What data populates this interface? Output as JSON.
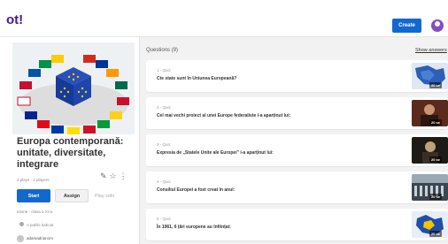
{
  "topbar": {
    "logo": "ot!",
    "create_label": "Create"
  },
  "kahoot": {
    "title": "Europa contemporană: unitate, diversitate, integrare",
    "meta": "2 plays · 2 players",
    "start_label": "Start",
    "assign_label": "Assign",
    "play_solo_label": "Play solo",
    "category": "Istorie · clasa a XI-a",
    "visibility": "A public kahoot",
    "author": "adamadrian1m"
  },
  "questions": {
    "header": "Questions (9)",
    "show_answers": "Show answers",
    "items": [
      {
        "label": "1 - Quiz",
        "text": "Cte state sunt în Uniunea Europeană?",
        "duration": "20 se"
      },
      {
        "label": "2 - Quiz",
        "text": "Cel mai vechi proiect al unei Europe federaliste i-a aparținut lui:",
        "duration": "20 se"
      },
      {
        "label": "3 - Quiz",
        "text": "Expresia de „Statele Unite ale Europei\" i-a aparținut lui:",
        "duration": "20 se"
      },
      {
        "label": "4 - Quiz",
        "text": "Consiliul Europei a fost creat în anul:",
        "duration": "20 se"
      },
      {
        "label": "5 - Quiz",
        "text": "În 1961, 6 țări europene au înființat:",
        "duration": "20 se"
      }
    ]
  }
}
